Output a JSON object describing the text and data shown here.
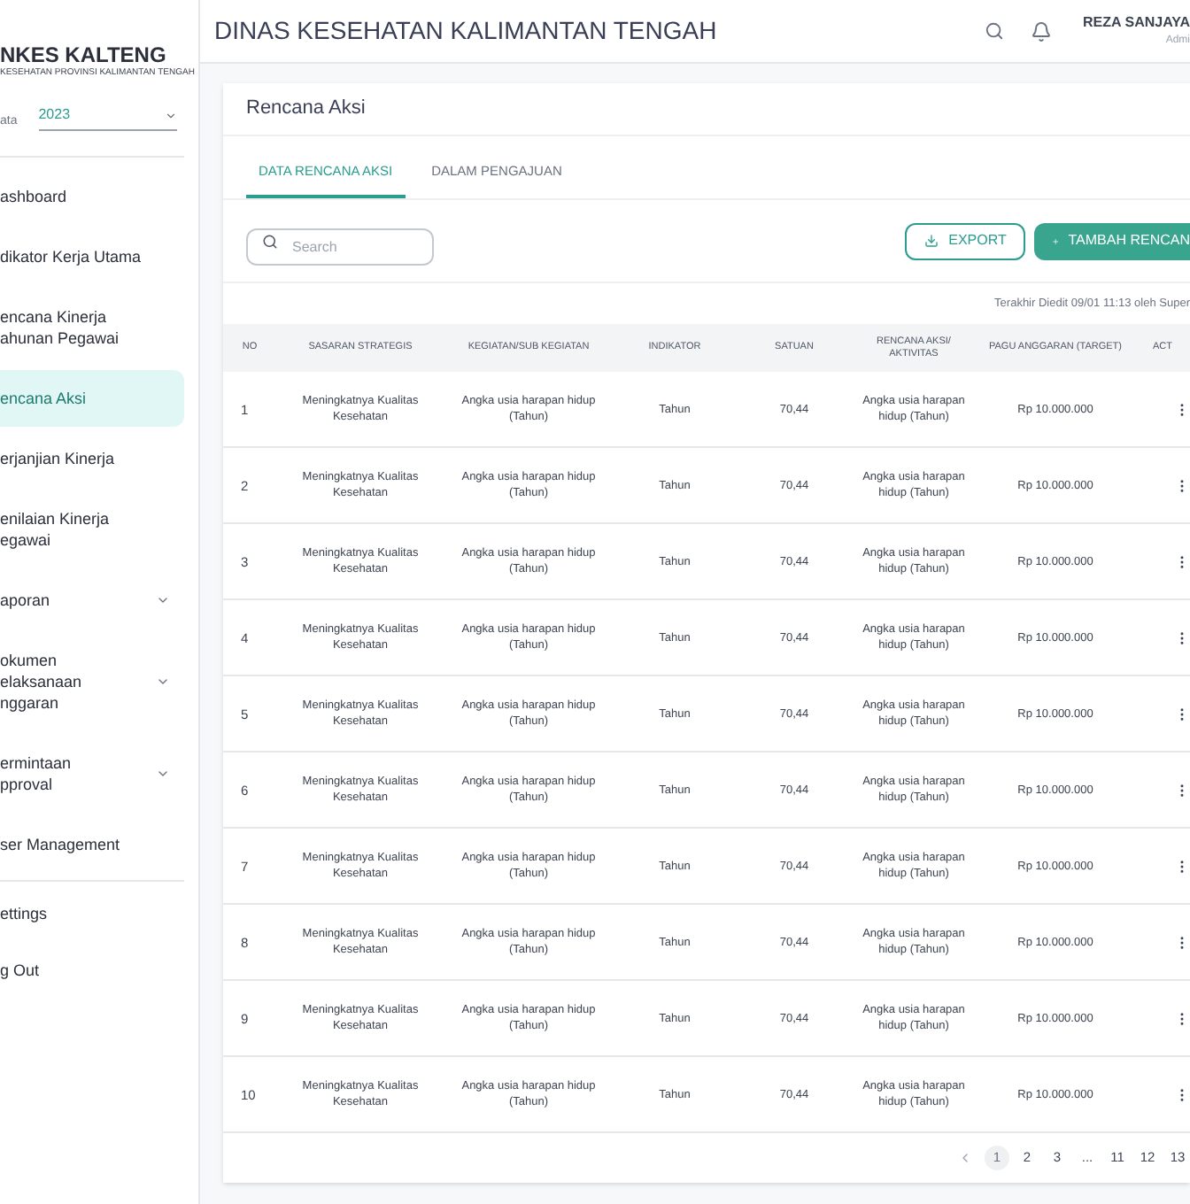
{
  "sidebar": {
    "logo": "NKES KALTENG",
    "logo_subtitle": "KESEHATAN PROVINSI KALIMANTAN TENGAH",
    "year_label": "ata",
    "year_value": "2023",
    "items": [
      {
        "lines": [
          "ashboard"
        ],
        "selected": false,
        "expandable": false
      },
      {
        "lines": [
          "dikator Kerja Utama"
        ],
        "selected": false,
        "expandable": false
      },
      {
        "lines": [
          "encana Kinerja",
          "ahunan Pegawai"
        ],
        "selected": false,
        "expandable": false
      },
      {
        "lines": [
          "encana Aksi"
        ],
        "selected": true,
        "expandable": false
      },
      {
        "lines": [
          "erjanjian Kinerja"
        ],
        "selected": false,
        "expandable": false
      },
      {
        "lines": [
          "enilaian Kinerja",
          "egawai"
        ],
        "selected": false,
        "expandable": false
      },
      {
        "lines": [
          "aporan"
        ],
        "selected": false,
        "expandable": true
      },
      {
        "lines": [
          "okumen",
          "elaksanaan",
          "nggaran"
        ],
        "selected": false,
        "expandable": true
      },
      {
        "lines": [
          "ermintaan",
          "pproval"
        ],
        "selected": false,
        "expandable": true
      },
      {
        "lines": [
          "ser Management"
        ],
        "selected": false,
        "expandable": false
      }
    ],
    "bottom_items": [
      "ettings",
      "g Out"
    ]
  },
  "header": {
    "title": "DINAS KESEHATAN KALIMANTAN TENGAH",
    "user_name": "REZA SANJAYA",
    "user_role": "Admi"
  },
  "page": {
    "title": "Rencana Aksi",
    "tabs": [
      {
        "label": "DATA RENCANA AKSI",
        "selected": true
      },
      {
        "label": "DALAM PENGAJUAN",
        "selected": false
      }
    ],
    "search": {
      "placeholder": "Search"
    },
    "export_button": "EXPORT",
    "add_button": "TAMBAH RENCAN",
    "last_edited": "Terakhir Diedit 09/01 11:13 oleh Super",
    "table": {
      "columns": [
        "NO",
        "SASARAN STRATEGIS",
        "KEGIATAN/SUB KEGIATAN",
        "INDIKATOR",
        "SATUAN",
        "RENCANA AKSI/ AKTIVITAS",
        "PAGU ANGGARAN (TARGET)",
        "ACT"
      ],
      "rows": [
        [
          "1",
          "Meningkatnya Kualitas Kesehatan",
          "Angka usia harapan hidup (Tahun)",
          "Tahun",
          "70,44",
          "Angka usia harapan hidup (Tahun)",
          "Rp 10.000.000"
        ],
        [
          "2",
          "Meningkatnya Kualitas Kesehatan",
          "Angka usia harapan hidup (Tahun)",
          "Tahun",
          "70,44",
          "Angka usia harapan hidup (Tahun)",
          "Rp 10.000.000"
        ],
        [
          "3",
          "Meningkatnya Kualitas Kesehatan",
          "Angka usia harapan hidup (Tahun)",
          "Tahun",
          "70,44",
          "Angka usia harapan hidup (Tahun)",
          "Rp 10.000.000"
        ],
        [
          "4",
          "Meningkatnya Kualitas Kesehatan",
          "Angka usia harapan hidup (Tahun)",
          "Tahun",
          "70,44",
          "Angka usia harapan hidup (Tahun)",
          "Rp 10.000.000"
        ],
        [
          "5",
          "Meningkatnya Kualitas Kesehatan",
          "Angka usia harapan hidup (Tahun)",
          "Tahun",
          "70,44",
          "Angka usia harapan hidup (Tahun)",
          "Rp 10.000.000"
        ],
        [
          "6",
          "Meningkatnya Kualitas Kesehatan",
          "Angka usia harapan hidup (Tahun)",
          "Tahun",
          "70,44",
          "Angka usia harapan hidup (Tahun)",
          "Rp 10.000.000"
        ],
        [
          "7",
          "Meningkatnya Kualitas Kesehatan",
          "Angka usia harapan hidup (Tahun)",
          "Tahun",
          "70,44",
          "Angka usia harapan hidup (Tahun)",
          "Rp 10.000.000"
        ],
        [
          "8",
          "Meningkatnya Kualitas Kesehatan",
          "Angka usia harapan hidup (Tahun)",
          "Tahun",
          "70,44",
          "Angka usia harapan hidup (Tahun)",
          "Rp 10.000.000"
        ],
        [
          "9",
          "Meningkatnya Kualitas Kesehatan",
          "Angka usia harapan hidup (Tahun)",
          "Tahun",
          "70,44",
          "Angka usia harapan hidup (Tahun)",
          "Rp 10.000.000"
        ],
        [
          "10",
          "Meningkatnya Kualitas Kesehatan",
          "Angka usia harapan hidup (Tahun)",
          "Tahun",
          "70,44",
          "Angka usia harapan hidup (Tahun)",
          "Rp 10.000.000"
        ]
      ]
    },
    "pagination": [
      {
        "label": "1",
        "selected": true
      },
      {
        "label": "2",
        "selected": false
      },
      {
        "label": "3",
        "selected": false
      },
      {
        "label": "...",
        "selected": false
      },
      {
        "label": "11",
        "selected": false
      },
      {
        "label": "12",
        "selected": false
      },
      {
        "label": "13",
        "selected": false
      }
    ]
  }
}
